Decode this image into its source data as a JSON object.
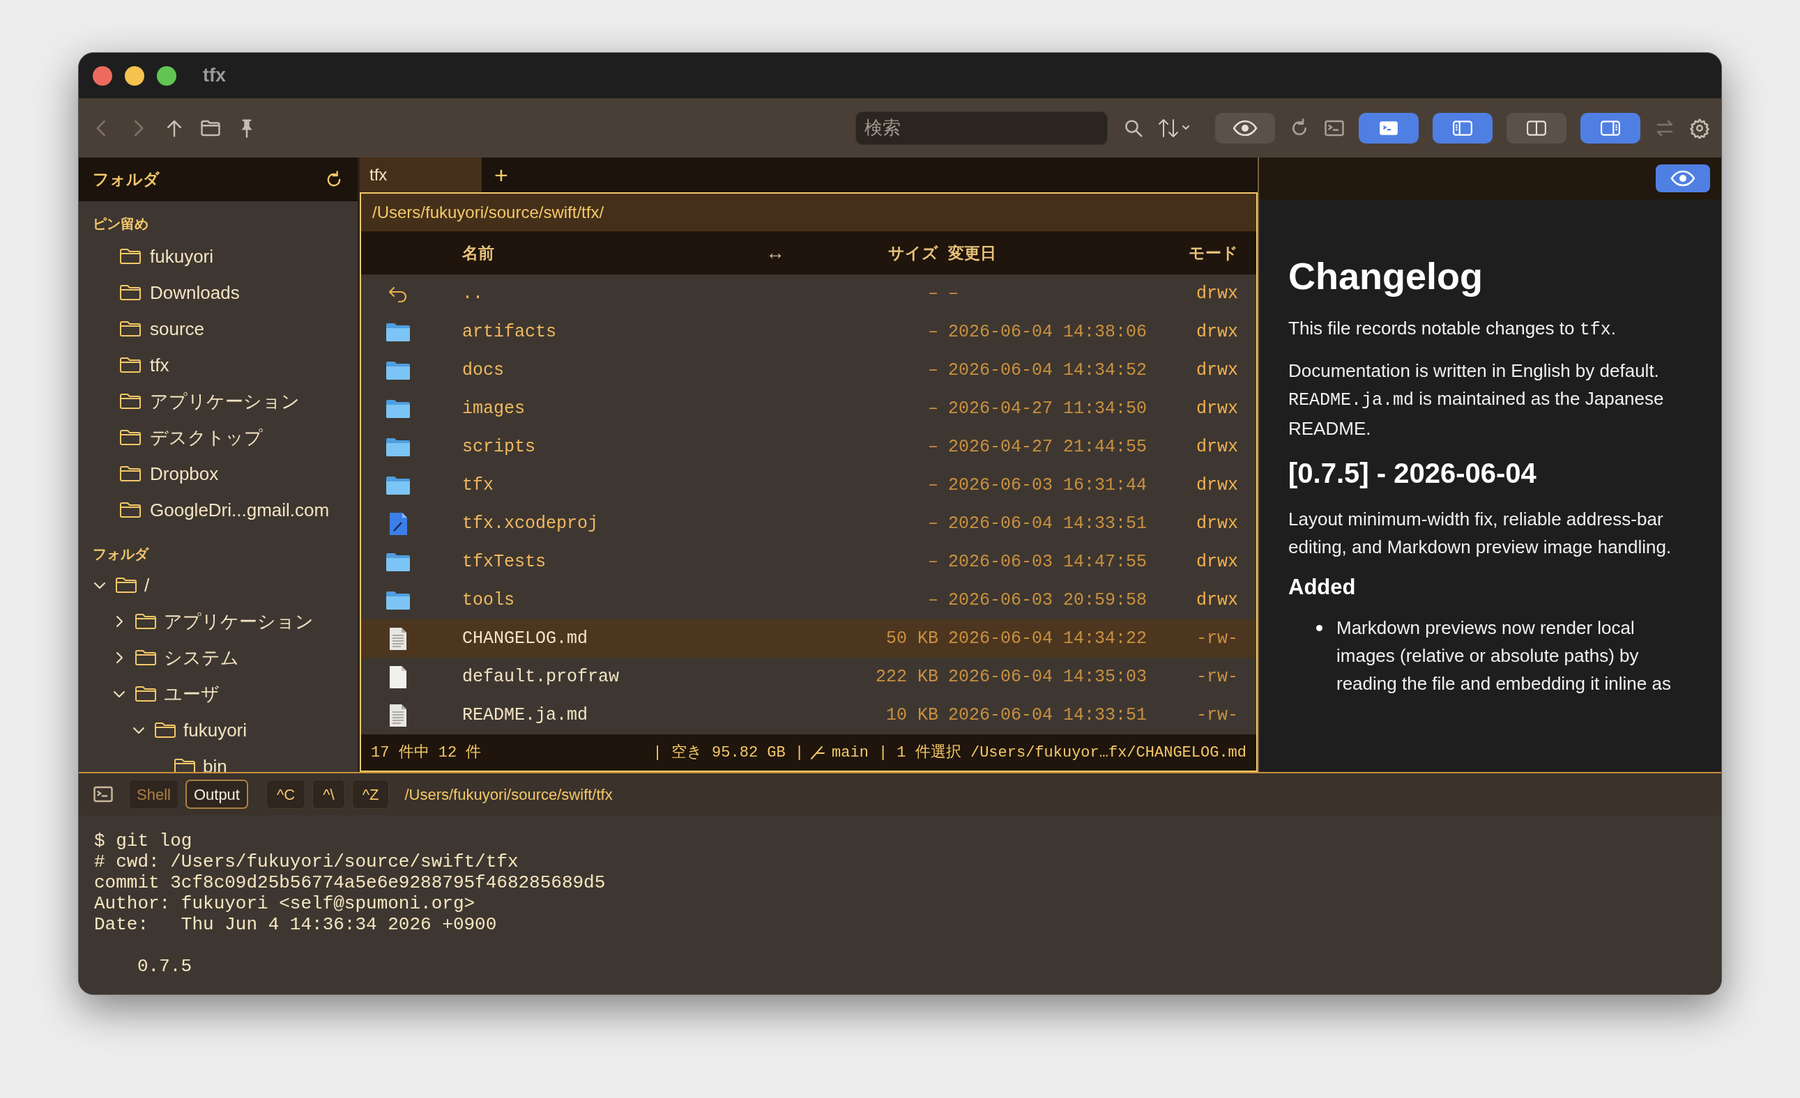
{
  "window": {
    "title": "tfx"
  },
  "toolbar": {
    "nav": [
      {
        "kind": "back",
        "disabled": true
      },
      {
        "kind": "forward",
        "disabled": true
      },
      {
        "kind": "up",
        "disabled": false
      },
      {
        "kind": "folder",
        "disabled": false
      },
      {
        "kind": "pin",
        "disabled": false
      }
    ],
    "search": {
      "placeholder": "検索"
    },
    "actions": [
      {
        "kind": "search"
      },
      {
        "kind": "sort"
      }
    ],
    "preview_toggle": {
      "on": false
    },
    "commands": [
      {
        "kind": "refresh"
      },
      {
        "kind": "terminal"
      }
    ],
    "panel_toggles": [
      {
        "kind": "terminal",
        "on": true
      },
      {
        "kind": "left-pane",
        "on": true
      },
      {
        "kind": "split",
        "on": false
      },
      {
        "kind": "right-pane",
        "on": true
      }
    ],
    "trailing": [
      {
        "kind": "swap",
        "disabled": true
      },
      {
        "kind": "settings",
        "disabled": false
      }
    ]
  },
  "sidebar": {
    "title": "フォルダ",
    "pinned_heading": "ピン留め",
    "pinned": [
      "fukuyori",
      "Downloads",
      "source",
      "tfx",
      "アプリケーション",
      "デスクトップ",
      "Dropbox",
      "GoogleDri...gmail.com"
    ],
    "tree_heading": "フォルダ",
    "tree": [
      {
        "label": "/",
        "expanded": true,
        "children": [
          {
            "label": "アプリケーション",
            "expanded": false
          },
          {
            "label": "システム",
            "expanded": false
          },
          {
            "label": "ユーザ",
            "expanded": true,
            "children": [
              {
                "label": "fukuyori",
                "expanded": true,
                "children": [
                  {
                    "label": "bin"
                  }
                ]
              }
            ]
          }
        ]
      }
    ]
  },
  "browser": {
    "tabs": [
      {
        "label": "tfx",
        "selected": true
      }
    ],
    "new_tab": "+",
    "path": "/Users/fukuyori/source/swift/tfx/",
    "columns": [
      "名前",
      "↔",
      "サイズ",
      "変更日",
      "モード"
    ],
    "rows": [
      {
        "kind": "parent",
        "name": "..",
        "size": "–",
        "modified": "–",
        "mode": "drwx",
        "selected": false
      },
      {
        "kind": "folder",
        "name": "artifacts",
        "size": "–",
        "modified": "2026-06-04 14:38:06",
        "mode": "drwx",
        "selected": false
      },
      {
        "kind": "folder",
        "name": "docs",
        "size": "–",
        "modified": "2026-06-04 14:34:52",
        "mode": "drwx",
        "selected": false
      },
      {
        "kind": "folder",
        "name": "images",
        "size": "–",
        "modified": "2026-04-27 11:34:50",
        "mode": "drwx",
        "selected": false
      },
      {
        "kind": "folder",
        "name": "scripts",
        "size": "–",
        "modified": "2026-04-27 21:44:55",
        "mode": "drwx",
        "selected": false
      },
      {
        "kind": "folder",
        "name": "tfx",
        "size": "–",
        "modified": "2026-06-03 16:31:44",
        "mode": "drwx",
        "selected": false
      },
      {
        "kind": "project",
        "name": "tfx.xcodeproj",
        "size": "–",
        "modified": "2026-06-04 14:33:51",
        "mode": "drwx",
        "selected": false
      },
      {
        "kind": "folder",
        "name": "tfxTests",
        "size": "–",
        "modified": "2026-06-03 14:47:55",
        "mode": "drwx",
        "selected": false
      },
      {
        "kind": "folder",
        "name": "tools",
        "size": "–",
        "modified": "2026-06-03 20:59:58",
        "mode": "drwx",
        "selected": false
      },
      {
        "kind": "text",
        "name": "CHANGELOG.md",
        "size": "50 KB",
        "modified": "2026-06-04 14:34:22",
        "mode": "-rw-",
        "selected": true
      },
      {
        "kind": "blank",
        "name": "default.profraw",
        "size": "222 KB",
        "modified": "2026-06-04 14:35:03",
        "mode": "-rw-",
        "selected": false
      },
      {
        "kind": "text",
        "name": "README.ja.md",
        "size": "10 KB",
        "modified": "2026-06-04 14:33:51",
        "mode": "-rw-",
        "selected": false
      }
    ],
    "status": {
      "count": "17 件中 12 件",
      "free": "| 空き 95.82 GB |",
      "branch": "main",
      "selection": "| 1 件選択 /Users/fukuyor…fx/CHANGELOG.md"
    }
  },
  "preview": {
    "toggle": {
      "on": true
    },
    "blocks": [
      {
        "kind": "h1",
        "lines": [
          [
            {
              "text": "Changelog",
              "code": false
            }
          ]
        ]
      },
      {
        "kind": "p",
        "lines": [
          [
            {
              "text": "This file records notable changes to ",
              "code": false
            },
            {
              "text": "tfx",
              "code": true
            },
            {
              "text": ".",
              "code": false
            }
          ]
        ]
      },
      {
        "kind": "p",
        "lines": [
          [
            {
              "text": "Documentation is written in English by default.",
              "code": false
            }
          ],
          [
            {
              "text": "README.ja.md",
              "code": true
            },
            {
              "text": " is maintained as the Japanese",
              "code": false
            }
          ],
          [
            {
              "text": "README.",
              "code": false
            }
          ]
        ]
      },
      {
        "kind": "h2",
        "lines": [
          [
            {
              "text": "[0.7.5] - 2026-06-04",
              "code": false
            }
          ]
        ]
      },
      {
        "kind": "p",
        "lines": [
          [
            {
              "text": "Layout minimum-width fix, reliable address-bar",
              "code": false
            }
          ],
          [
            {
              "text": "editing, and Markdown preview image handling.",
              "code": false
            }
          ]
        ]
      },
      {
        "kind": "h3",
        "lines": [
          [
            {
              "text": "Added",
              "code": false
            }
          ]
        ]
      },
      {
        "kind": "li",
        "lines": [
          [
            {
              "text": "Markdown previews now render local",
              "code": false
            }
          ],
          [
            {
              "text": "images (relative or absolute paths) by",
              "code": false
            }
          ],
          [
            {
              "text": "reading the file and embedding it inline as",
              "code": false
            }
          ]
        ]
      }
    ]
  },
  "terminal": {
    "modes": [
      {
        "label": "Shell",
        "selected": false
      },
      {
        "label": "Output",
        "selected": true
      }
    ],
    "keys": [
      "^C",
      "^\\",
      "^Z"
    ],
    "cwd": "/Users/fukuyori/source/swift/tfx",
    "lines": [
      "$ git log",
      "# cwd: /Users/fukuyori/source/swift/tfx",
      "commit 3cf8c09d25b56774a5e6e9288795f468285689d5",
      "Author: fukuyori <self@spumoni.org>",
      "Date:   Thu Jun 4 14:36:34 2026 +0900"
    ],
    "message": "0.7.5"
  }
}
